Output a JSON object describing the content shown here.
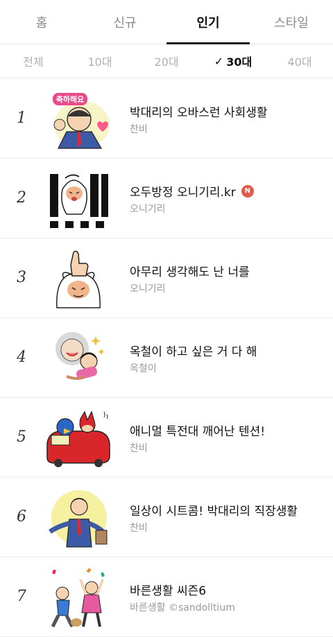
{
  "tabs": [
    {
      "label": "홈",
      "active": false
    },
    {
      "label": "신규",
      "active": false
    },
    {
      "label": "인기",
      "active": true
    },
    {
      "label": "스타일",
      "active": false
    }
  ],
  "age_filters": [
    {
      "label": "전체",
      "active": false
    },
    {
      "label": "10대",
      "active": false
    },
    {
      "label": "20대",
      "active": false
    },
    {
      "label": "30대",
      "active": true
    },
    {
      "label": "40대",
      "active": false
    }
  ],
  "check_glyph": "✓",
  "items": [
    {
      "rank": "1",
      "title": "박대리의 오바스런 사회생활",
      "subtitle": "찬비",
      "icon": "office-worker-heart-sticker",
      "thumb_text": "축하해요"
    },
    {
      "rank": "2",
      "title": "오두방정 오니기리.kr",
      "subtitle": "오니기리",
      "icon": "onigiri-exclaim-sticker",
      "badge": "N"
    },
    {
      "rank": "3",
      "title": "아무리 생각해도 난 너를",
      "subtitle": "오니기리",
      "icon": "onigiri-thumbs-up-sticker"
    },
    {
      "rank": "4",
      "title": "옥철이 하고 싶은 거 다 해",
      "subtitle": "옥철이",
      "icon": "grandma-girl-sticker"
    },
    {
      "rank": "5",
      "title": "애니멀 특전대 깨어난 텐션!",
      "subtitle": "찬비",
      "icon": "animals-red-car-sticker"
    },
    {
      "rank": "6",
      "title": "일상이 시트콤! 박대리의 직장생활",
      "subtitle": "찬비",
      "icon": "office-worker-shrug-sticker"
    },
    {
      "rank": "7",
      "title": "바른생활 씨즌6",
      "subtitle": "바른생활 ©sandolltium",
      "icon": "celebrating-people-sticker"
    }
  ],
  "colors": {
    "accent": "#111111",
    "badge": "#e25a4b",
    "muted": "#9a9a9a"
  }
}
